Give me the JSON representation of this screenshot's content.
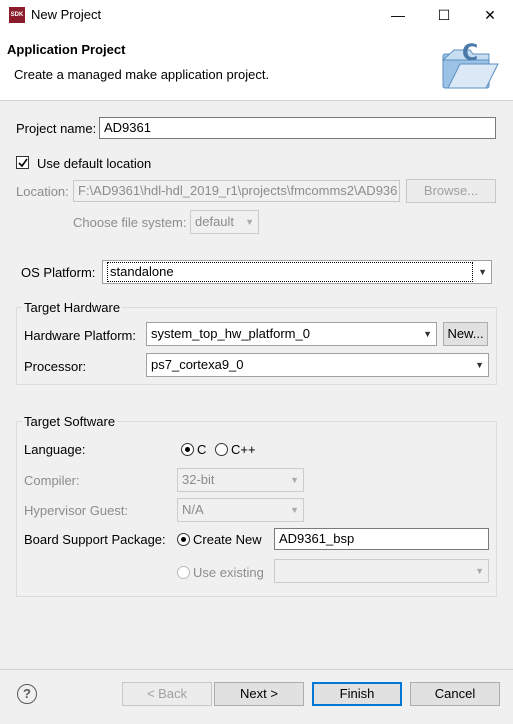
{
  "window": {
    "icon_text": "SDK",
    "title": "New Project",
    "minimize": "—",
    "maximize": "☐",
    "close": "✕"
  },
  "header": {
    "title": "Application Project",
    "description": "Create a managed make application project."
  },
  "project": {
    "name_label": "Project name:",
    "name_value": "AD9361",
    "use_default_label": "Use default location",
    "location_label": "Location:",
    "location_value": "F:\\AD9361\\hdl-hdl_2019_r1\\projects\\fmcomms2\\AD936",
    "browse_label": "Browse...",
    "filesystem_label": "Choose file system:",
    "filesystem_value": "default"
  },
  "os": {
    "label": "OS Platform:",
    "value": "standalone"
  },
  "hardware": {
    "group_title": "Target Hardware",
    "platform_label": "Hardware Platform:",
    "platform_value": "system_top_hw_platform_0",
    "new_label": "New...",
    "processor_label": "Processor:",
    "processor_value": "ps7_cortexa9_0"
  },
  "software": {
    "group_title": "Target Software",
    "language_label": "Language:",
    "lang_c": "C",
    "lang_cpp": "C++",
    "compiler_label": "Compiler:",
    "compiler_value": "32-bit",
    "hypervisor_label": "Hypervisor Guest:",
    "hypervisor_value": "N/A",
    "bsp_label": "Board Support Package:",
    "create_new_label": "Create New",
    "bsp_name": "AD9361_bsp",
    "use_existing_label": "Use existing"
  },
  "footer": {
    "help": "?",
    "back": "< Back",
    "next": "Next >",
    "finish": "Finish",
    "cancel": "Cancel"
  }
}
